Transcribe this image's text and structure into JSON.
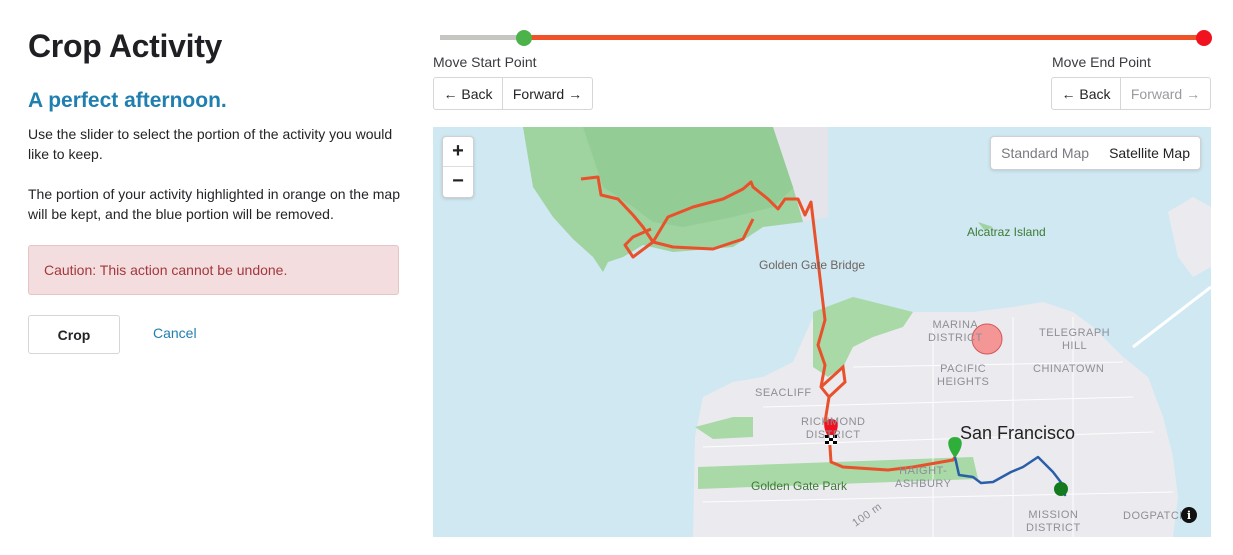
{
  "page": {
    "title": "Crop Activity",
    "activity_name": "A perfect afternoon.",
    "instructions_1": "Use the slider to select the portion of the activity you would like to keep.",
    "instructions_2": "The portion of your activity highlighted in orange on the map will be kept, and the blue portion will be removed.",
    "caution": "Caution: This action cannot be undone.",
    "crop_label": "Crop",
    "cancel_label": "Cancel"
  },
  "slider": {
    "start_fraction": 0.11,
    "end_fraction": 1.0,
    "colors": {
      "excluded": "#c3c6c1",
      "kept": "#f05126",
      "start_thumb": "#4bb34a",
      "end_thumb": "#f0121f"
    }
  },
  "start_controls": {
    "label": "Move Start Point",
    "back_label": "← Back",
    "forward_label": "Forward →"
  },
  "end_controls": {
    "label": "Move End Point",
    "back_label": "← Back",
    "forward_label": "Forward →",
    "forward_disabled": true
  },
  "map": {
    "zoom_in": "+",
    "zoom_out": "−",
    "map_types": [
      "Standard Map",
      "Satellite Map"
    ],
    "selected_map_type": "Satellite Map",
    "info_icon": "i",
    "labels": {
      "golden_gate_bridge": "Golden Gate Bridge",
      "alcatraz": "Alcatraz Island",
      "marina": "MARINA\nDISTRICT",
      "telegraph": "TELEGRAPH\nHILL",
      "pacific_heights": "PACIFIC\nHEIGHTS",
      "chinatown": "CHINATOWN",
      "seacliff": "SEACLIFF",
      "richmond": "RICHMOND\nDISTRICT",
      "city": "San Francisco",
      "ggpark": "Golden Gate Park",
      "haight": "HAIGHT-\nASHBURY",
      "mission": "MISSION\nDISTRICT",
      "dogpatch": "DOGPATCH",
      "contour": "100 m"
    },
    "route_colors": {
      "kept": "#e8512b",
      "removed": "#2a5ea8"
    }
  }
}
